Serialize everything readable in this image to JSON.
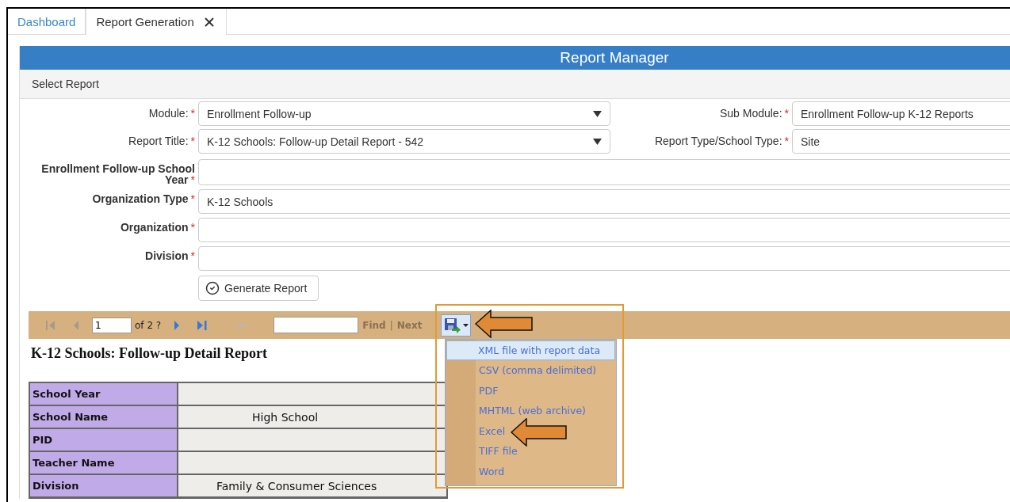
{
  "tabs": [
    {
      "label": "Dashboard",
      "selected": false,
      "closable": false
    },
    {
      "label": "Report Generation",
      "selected": true,
      "closable": true
    }
  ],
  "panel": {
    "title": "Report Manager",
    "section": "Select Report",
    "field_pairs": [
      {
        "left": {
          "label": "Module:",
          "marker": "*",
          "value": "Enrollment Follow-up",
          "kind": "select"
        },
        "right": {
          "label": "Sub Module:",
          "marker": "*",
          "value": "Enrollment Follow-up K-12 Reports"
        }
      },
      {
        "left": {
          "label": "Report Title:",
          "marker": "*",
          "value": "K-12 Schools: Follow-up Detail Report - 542",
          "kind": "select"
        },
        "right": {
          "label": "Report Type/School Type:",
          "marker": "*",
          "value": "Site"
        }
      }
    ],
    "fields": [
      {
        "label": "Enrollment Follow-up School Year",
        "marker": "*"
      },
      {
        "label": "Organization Type",
        "marker": "*",
        "value": "K-12 Schools"
      },
      {
        "label": "Organization",
        "marker": "*"
      },
      {
        "label": "Division",
        "marker": "*"
      }
    ],
    "generate_button": "Generate Report"
  },
  "viewer": {
    "toolbar": {
      "nav": [
        {
          "kind": "first",
          "disabled": true
        },
        {
          "kind": "prev",
          "disabled": true
        }
      ],
      "page": "1",
      "page_count": "of 2 ?",
      "nav_after": [
        {
          "kind": "next",
          "disabled": false
        },
        {
          "kind": "last",
          "disabled": false
        },
        {
          "kind": "back",
          "disabled": true
        }
      ],
      "find": "Find",
      "separator": "|",
      "next": "Next",
      "find_disabled": true
    },
    "export_menu": {
      "items": [
        {
          "label": "XML file with report data",
          "selected": true
        },
        {
          "label": "CSV (comma delimited)",
          "selected": false
        },
        {
          "label": "PDF",
          "selected": false
        },
        {
          "label": "MHTML (web archive)",
          "selected": false
        },
        {
          "label": "Excel",
          "selected": false
        },
        {
          "label": "TIFF file",
          "selected": false
        },
        {
          "label": "Word",
          "selected": false
        }
      ]
    },
    "report": {
      "title": "K-12 Schools: Follow-up Detail Report",
      "rows": [
        {
          "label": "School Year"
        },
        {
          "label": "School Name",
          "value": "High School"
        },
        {
          "label": "PID"
        },
        {
          "label": "Teacher Name"
        },
        {
          "label": "Division",
          "value": "Family & Consumer Sciences"
        }
      ]
    }
  }
}
